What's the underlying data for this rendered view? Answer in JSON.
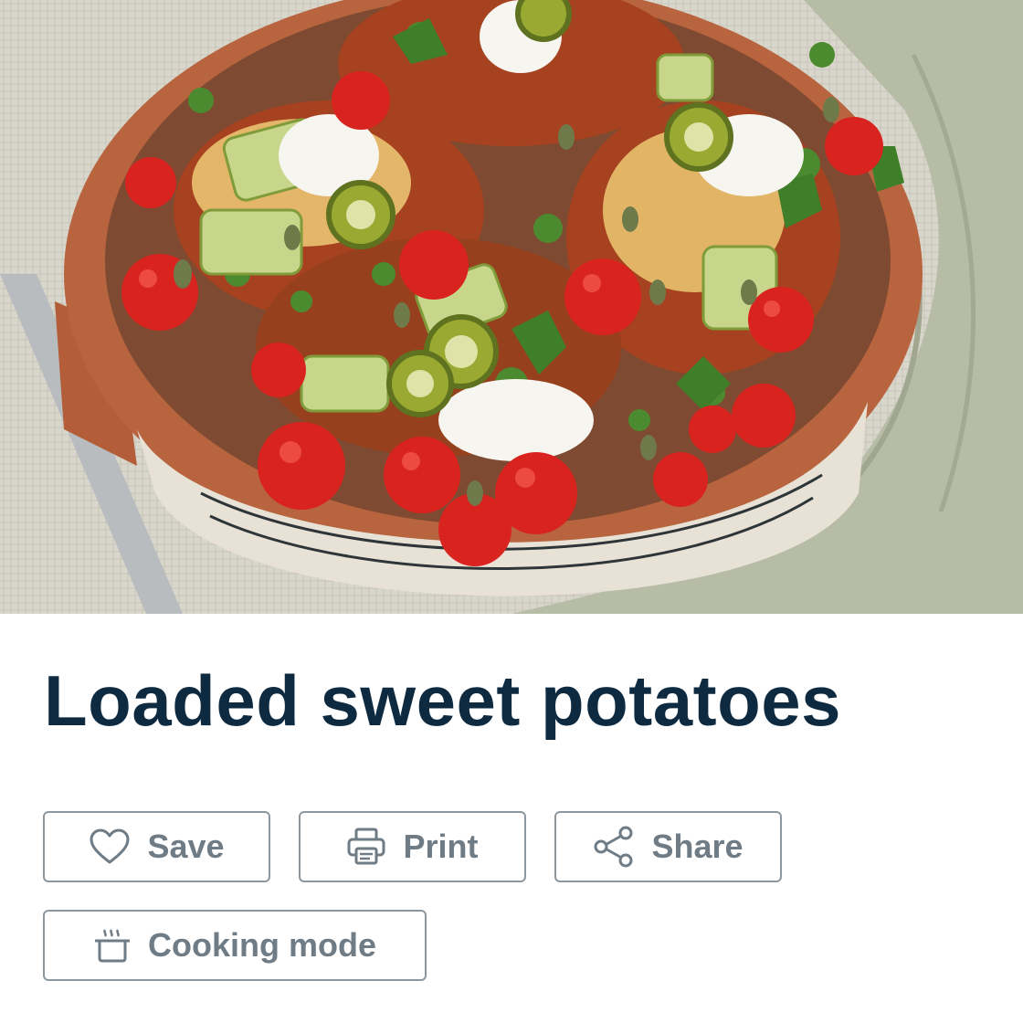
{
  "recipe": {
    "title": "Loaded sweet potatoes",
    "photo_subject": "loaded-sweet-potatoes-dish"
  },
  "actions": {
    "save": {
      "label": "Save",
      "icon": "heart-icon"
    },
    "print": {
      "label": "Print",
      "icon": "printer-icon"
    },
    "share": {
      "label": "Share",
      "icon": "share-icon"
    },
    "cooking_mode": {
      "label": "Cooking mode",
      "icon": "cooking-pot-icon"
    }
  },
  "colors": {
    "title": "#0e2a40",
    "button_border": "#8c979f",
    "button_text": "#6f7c86"
  }
}
